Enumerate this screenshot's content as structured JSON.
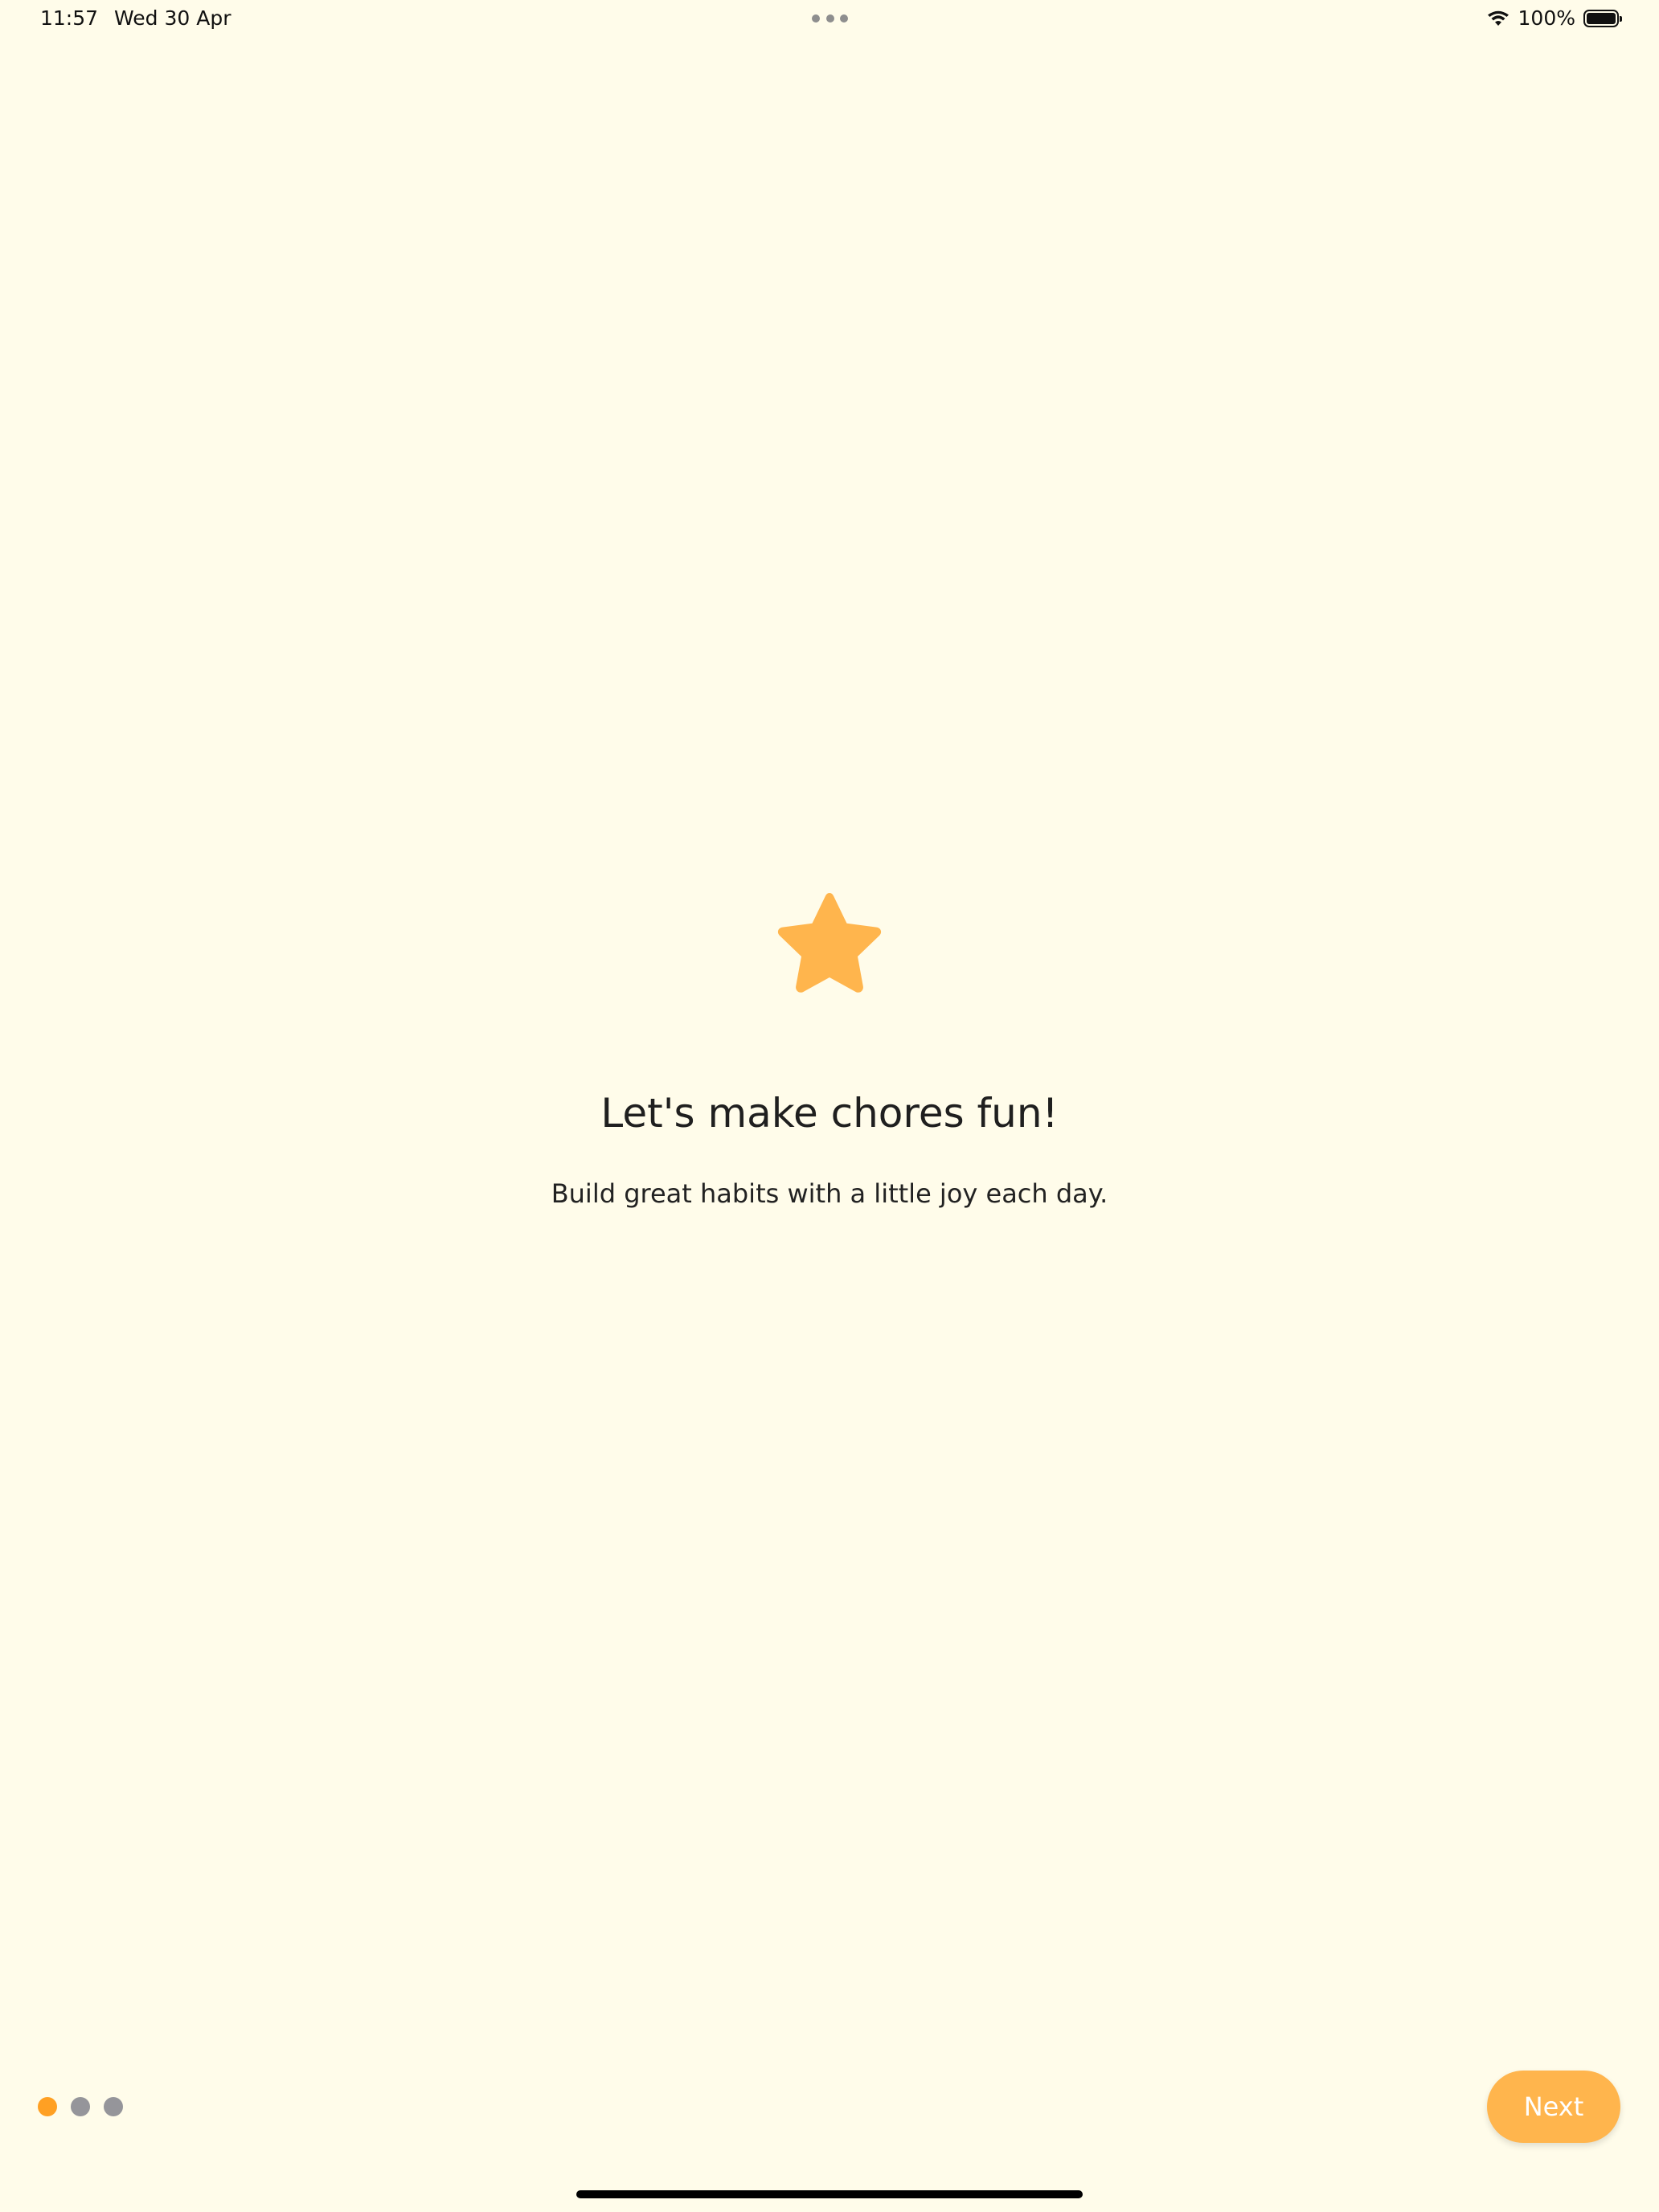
{
  "status_bar": {
    "time": "11:57",
    "date": "Wed 30 Apr",
    "battery_percent": "100%",
    "battery_level": 1.0
  },
  "onboarding": {
    "icon": "star-icon",
    "title": "Let's make chores fun!",
    "subtitle": "Build great habits with a little joy each day.",
    "page_indicator": {
      "total_pages": 3,
      "current_page": 1
    },
    "next_label": "Next"
  },
  "colors": {
    "background": "#FFFCEA",
    "accent": "#FFB54D",
    "active_dot": "#FFA023",
    "inactive_dot": "#95959A"
  }
}
